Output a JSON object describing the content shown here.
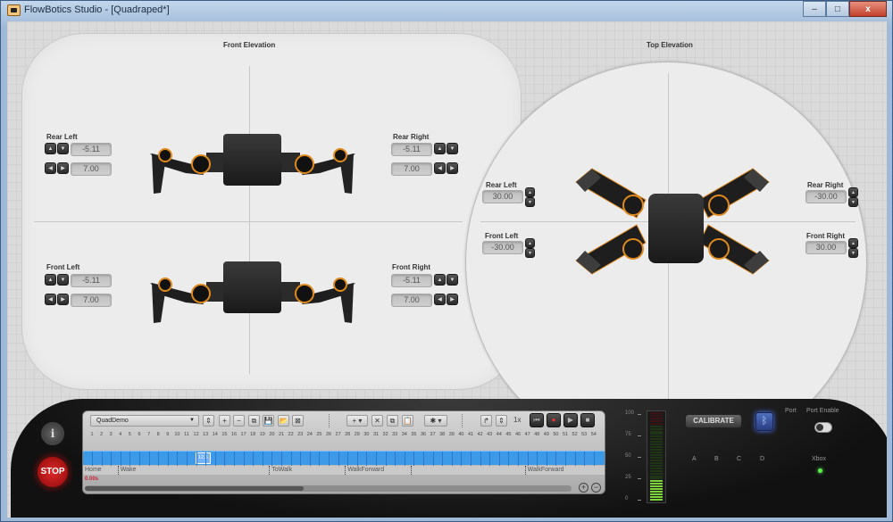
{
  "window": {
    "title": "FlowBotics Studio - [Quadraped*]",
    "controls": {
      "minimize": "–",
      "maximize": "□",
      "close": "x"
    }
  },
  "front_elevation": {
    "title": "Front Elevation",
    "legs": {
      "rear_left": {
        "label": "Rear Left",
        "value1": "-5.11",
        "value2": "7.00"
      },
      "rear_right": {
        "label": "Rear Right",
        "value1": "-5.11",
        "value2": "7.00"
      },
      "front_left": {
        "label": "Front Left",
        "value1": "-5.11",
        "value2": "7.00"
      },
      "front_right": {
        "label": "Front Right",
        "value1": "-5.11",
        "value2": "7.00"
      }
    }
  },
  "top_elevation": {
    "title": "Top Elevation",
    "legs": {
      "rear_left": {
        "label": "Rear Left",
        "value": "30.00"
      },
      "rear_right": {
        "label": "Rear Right",
        "value": "-30.00"
      },
      "front_left": {
        "label": "Front Left",
        "value": "-30.00"
      },
      "front_right": {
        "label": "Front Right",
        "value": "30.00"
      }
    }
  },
  "controls": {
    "info_label": "i",
    "stop_label": "STOP"
  },
  "timeline": {
    "sequence": "QuadDemo",
    "speed": "1x",
    "cursor_frame": "12.5",
    "time_readout": "0.00s",
    "ruler": [
      "1",
      "2",
      "3",
      "4",
      "5",
      "6",
      "7",
      "8",
      "9",
      "10",
      "11",
      "12",
      "13",
      "14",
      "15",
      "16",
      "17",
      "18",
      "19",
      "20",
      "21",
      "22",
      "23",
      "24",
      "25",
      "26",
      "27",
      "28",
      "29",
      "30",
      "31",
      "32",
      "33",
      "34",
      "35",
      "36",
      "37",
      "38",
      "39",
      "40",
      "41",
      "42",
      "43",
      "44",
      "45",
      "46",
      "47",
      "48",
      "49",
      "50",
      "51",
      "52",
      "53",
      "54"
    ],
    "segments": [
      {
        "label": "Home",
        "start": 1
      },
      {
        "label": "Wake",
        "start": 4
      },
      {
        "label": "ToWalk",
        "start": 20
      },
      {
        "label": "WalkForward",
        "start": 28
      },
      {
        "label": "",
        "start": 35
      },
      {
        "label": "WalkForward",
        "start": 47
      }
    ],
    "icons": {
      "sequence_dropdown": "▼",
      "stepper": "⇕",
      "add": "+",
      "remove": "−",
      "copy": "⧉",
      "save": "💾",
      "open": "📂",
      "delete": "⊠",
      "add_menu": "+ ▾",
      "cut": "✕",
      "duplicate": "⧉",
      "paste": "📋",
      "settings": "✱ ▾",
      "loop": "↱",
      "speed_stepper": "⇕",
      "rewind": "⏮",
      "record": "●",
      "play": "▶",
      "stop": "■",
      "zoom_in": "+",
      "zoom_out": "−"
    }
  },
  "meter": {
    "labels": [
      "100",
      "75",
      "50",
      "25",
      "0"
    ],
    "level_percent": 22
  },
  "right_controls": {
    "calibrate": "CALIBRATE",
    "bluetooth_icon": "ᛒ",
    "port_label": "Port",
    "port_enable_label": "Port Enable",
    "channels": [
      "A",
      "B",
      "C",
      "D"
    ],
    "xbox_label": "Xbox",
    "port_enabled": false,
    "xbox_connected": true
  },
  "colors": {
    "accent_orange": "#e08a1e",
    "timeline_blue": "#3d9ae8",
    "stop_red": "#d02020",
    "led_green": "#5cf04a",
    "bluetooth_blue": "#4c7cff"
  }
}
